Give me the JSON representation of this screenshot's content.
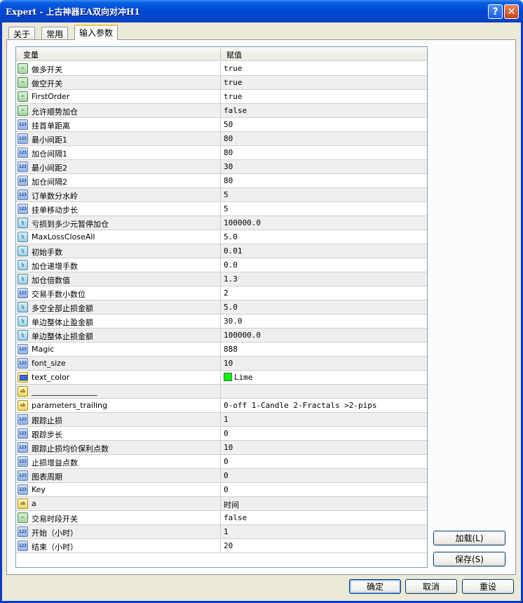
{
  "window": {
    "title": "Expert - 上古神器EA双向对冲H1"
  },
  "tabs": [
    {
      "label": "关于"
    },
    {
      "label": "常用"
    },
    {
      "label": "输入参数"
    }
  ],
  "grid": {
    "columns": {
      "variable": "变量",
      "value": "赋值"
    },
    "rows": [
      {
        "icon": "bool-type-icon",
        "name": "做多开关",
        "value": "true"
      },
      {
        "icon": "bool-type-icon",
        "name": "做空开关",
        "value": "true"
      },
      {
        "icon": "bool-type-icon",
        "name": "FirstOrder",
        "value": "true"
      },
      {
        "icon": "bool-type-icon",
        "name": "允许顺势加仓",
        "value": "false"
      },
      {
        "icon": "int-type-icon",
        "name": "挂首单距离",
        "value": "50"
      },
      {
        "icon": "int-type-icon",
        "name": "最小间距1",
        "value": "80"
      },
      {
        "icon": "int-type-icon",
        "name": "加仓间隔1",
        "value": "80"
      },
      {
        "icon": "int-type-icon",
        "name": "最小间距2",
        "value": "30"
      },
      {
        "icon": "int-type-icon",
        "name": "加仓间隔2",
        "value": "80"
      },
      {
        "icon": "int-type-icon",
        "name": "订单数分水岭",
        "value": "5"
      },
      {
        "icon": "int-type-icon",
        "name": "挂单移动步长",
        "value": "5"
      },
      {
        "icon": "double-type-icon",
        "name": "亏损到多少元暂停加仓",
        "value": "100000.0"
      },
      {
        "icon": "double-type-icon",
        "name": "MaxLossCloseAll",
        "value": "5.0"
      },
      {
        "icon": "double-type-icon",
        "name": "初始手数",
        "value": "0.01"
      },
      {
        "icon": "double-type-icon",
        "name": "加仓递增手数",
        "value": "0.0"
      },
      {
        "icon": "double-type-icon",
        "name": "加仓倍数值",
        "value": "1.3"
      },
      {
        "icon": "int-type-icon",
        "name": "交易手数小数位",
        "value": "2"
      },
      {
        "icon": "double-type-icon",
        "name": "多空全部止损金额",
        "value": "5.0"
      },
      {
        "icon": "double-type-icon",
        "name": "单边整体止盈金额",
        "value": "30.0"
      },
      {
        "icon": "double-type-icon",
        "name": "单边整体止损金额",
        "value": "100000.0"
      },
      {
        "icon": "int-type-icon",
        "name": "Magic",
        "value": "888"
      },
      {
        "icon": "int-type-icon",
        "name": "font_size",
        "value": "10"
      },
      {
        "icon": "color-type-icon",
        "name": "text_color",
        "value": "Lime",
        "swatch": "#00ff00"
      },
      {
        "icon": "string-type-icon",
        "name": "_________________",
        "value": ""
      },
      {
        "icon": "string-type-icon",
        "name": "parameters_trailing",
        "value": "0-off  1-Candle  2-Fractals  >2-pips"
      },
      {
        "icon": "int-type-icon",
        "name": "跟踪止损",
        "value": "1"
      },
      {
        "icon": "int-type-icon",
        "name": "跟踪步长",
        "value": "0"
      },
      {
        "icon": "int-type-icon",
        "name": "跟踪止损均价保利点数",
        "value": "10"
      },
      {
        "icon": "int-type-icon",
        "name": "止损增益点数",
        "value": "0"
      },
      {
        "icon": "int-type-icon",
        "name": "图表周期",
        "value": "0"
      },
      {
        "icon": "int-type-icon",
        "name": "Key",
        "value": "0"
      },
      {
        "icon": "string-type-icon",
        "name": "a",
        "value": "时间"
      },
      {
        "icon": "bool-type-icon",
        "name": "交易时段开关",
        "value": "false"
      },
      {
        "icon": "int-type-icon",
        "name": "开始（小时）",
        "value": "1"
      },
      {
        "icon": "int-type-icon",
        "name": "结束（小时）",
        "value": "20"
      }
    ]
  },
  "side_buttons": {
    "load": "加载(L)",
    "save": "保存(S)"
  },
  "footer_buttons": {
    "ok": "确定",
    "cancel": "取消",
    "reset": "重设"
  }
}
